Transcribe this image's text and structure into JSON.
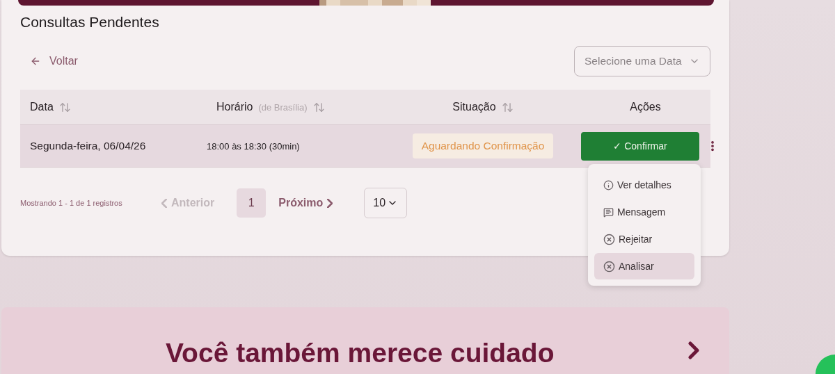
{
  "section": {
    "title": "Consultas Pendentes"
  },
  "back_link": {
    "label": "Voltar"
  },
  "date_select": {
    "placeholder": "Selecione uma Data"
  },
  "table": {
    "columns": [
      {
        "label": "Data",
        "sortable": true
      },
      {
        "label": "Horário",
        "note": "(de Brasília)",
        "sortable": true
      },
      {
        "label": "Situação",
        "sortable": true
      },
      {
        "label": "Ações",
        "sortable": false
      }
    ],
    "rows": [
      {
        "date": "Segunda-feira, 06/04/26",
        "time": "18:00 às 18:30 (30min)",
        "status": "Aguardando Confirmação",
        "action": "✓ Confirmar"
      }
    ]
  },
  "action_menu": {
    "items": [
      {
        "kind": "info",
        "label": "Ver detalhes",
        "selected": false
      },
      {
        "kind": "message",
        "label": "Mensagem",
        "selected": false
      },
      {
        "kind": "reject",
        "label": "Rejeitar",
        "selected": false
      },
      {
        "kind": "reject",
        "label": "Analisar",
        "selected": true
      }
    ]
  },
  "pagination": {
    "summary": "Mostrando 1 - 1 de 1 registros",
    "previous": {
      "label": "Anterior",
      "disabled": true
    },
    "pages": [
      {
        "label": "1",
        "selected": true
      }
    ],
    "next": {
      "label": "Próximo",
      "disabled": false
    },
    "page_size": "10"
  },
  "promo_banner": {
    "title": "Você também merece cuidado"
  }
}
